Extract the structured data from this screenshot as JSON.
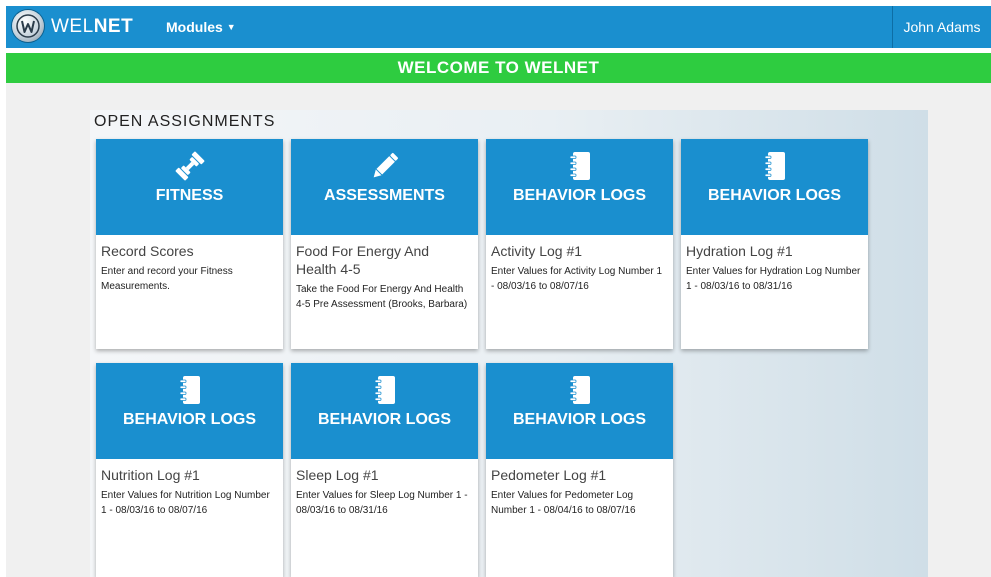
{
  "navbar": {
    "brand_light": "WEL",
    "brand_bold": "NET",
    "modules_label": "Modules",
    "caret": "▼",
    "user_name": "John Adams"
  },
  "banner": {
    "text": "WELCOME TO WELNET"
  },
  "section": {
    "title": "OPEN ASSIGNMENTS"
  },
  "colors": {
    "nav_blue": "#1a8fcf",
    "banner_green": "#2ecc40"
  },
  "cards": [
    {
      "icon": "dumbbell-icon",
      "category": "FITNESS",
      "title": "Record Scores",
      "description": "Enter and record your Fitness Measurements."
    },
    {
      "icon": "pencil-icon",
      "category": "ASSESSMENTS",
      "title": "Food For Energy And Health 4-5",
      "description": "Take the Food For Energy And Health 4-5 Pre Assessment (Brooks, Barbara)"
    },
    {
      "icon": "notebook-icon",
      "category": "BEHAVIOR LOGS",
      "title": "Activity Log #1",
      "description": "Enter Values for Activity Log Number 1 - 08/03/16 to 08/07/16"
    },
    {
      "icon": "notebook-icon",
      "category": "BEHAVIOR LOGS",
      "title": "Hydration Log #1",
      "description": "Enter Values for Hydration Log Number 1 - 08/03/16 to 08/31/16"
    },
    {
      "icon": "notebook-icon",
      "category": "BEHAVIOR LOGS",
      "title": "Nutrition Log #1",
      "description": "Enter Values for Nutrition Log Number 1 - 08/03/16 to 08/07/16"
    },
    {
      "icon": "notebook-icon",
      "category": "BEHAVIOR LOGS",
      "title": "Sleep Log #1",
      "description": "Enter Values for Sleep Log Number 1 - 08/03/16 to 08/31/16"
    },
    {
      "icon": "notebook-icon",
      "category": "BEHAVIOR LOGS",
      "title": "Pedometer Log #1",
      "description": "Enter Values for Pedometer Log Number 1 - 08/04/16 to 08/07/16"
    }
  ]
}
